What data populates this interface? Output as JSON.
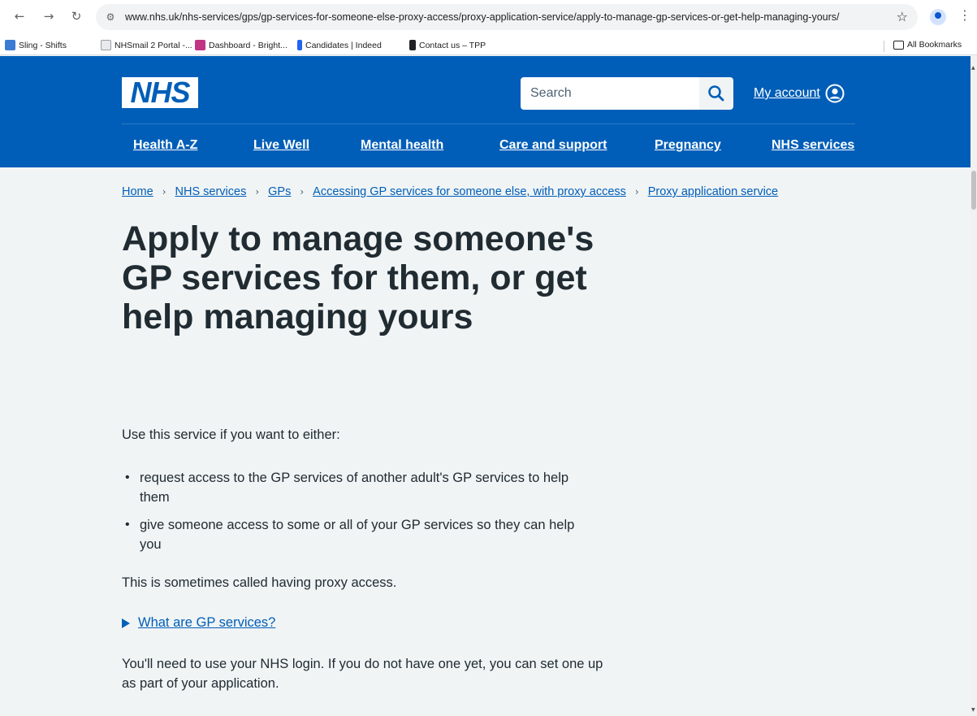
{
  "browser": {
    "url": "www.nhs.uk/nhs-services/gps/gp-services-for-someone-else-proxy-access/proxy-application-service/apply-to-manage-gp-services-or-get-help-managing-yours/",
    "bookmarks": [
      {
        "label": "Sling - Shifts",
        "icon_color": "#3a7bd5"
      },
      {
        "label": "NHSmail 2 Portal -...",
        "icon_color": "#9aa0a6"
      },
      {
        "label": "Dashboard - Bright...",
        "icon_color": "#c13584"
      },
      {
        "label": "Candidates | Indeed",
        "icon_color": "#2164f3"
      },
      {
        "label": "Contact us – TPP",
        "icon_color": "#202124"
      }
    ],
    "all_bookmarks": "All Bookmarks"
  },
  "header": {
    "logo": "NHS",
    "search_placeholder": "Search",
    "account_label": "My account",
    "nav": [
      "Health A-Z",
      "Live Well",
      "Mental health",
      "Care and support",
      "Pregnancy",
      "NHS services"
    ]
  },
  "breadcrumb": [
    "Home",
    "NHS services",
    "GPs",
    "Accessing GP services for someone else, with proxy access",
    "Proxy application service"
  ],
  "main": {
    "title": "Apply to manage someone's GP services for them, or get help managing yours",
    "intro": "Use this service if you want to either:",
    "bullets": [
      "request access to the GP services of another adult's GP services to help them",
      "give someone access to some or all of your GP services so they can help you"
    ],
    "proxy_text": "This is sometimes called having proxy access.",
    "details_label": "What are GP services?",
    "login_text": "You'll need to use your NHS login. If you do not have one yet, you can set one up as part of your application."
  },
  "colors": {
    "nhs_blue": "#005eb8",
    "page_bg": "#f0f4f5",
    "text": "#212b32"
  }
}
